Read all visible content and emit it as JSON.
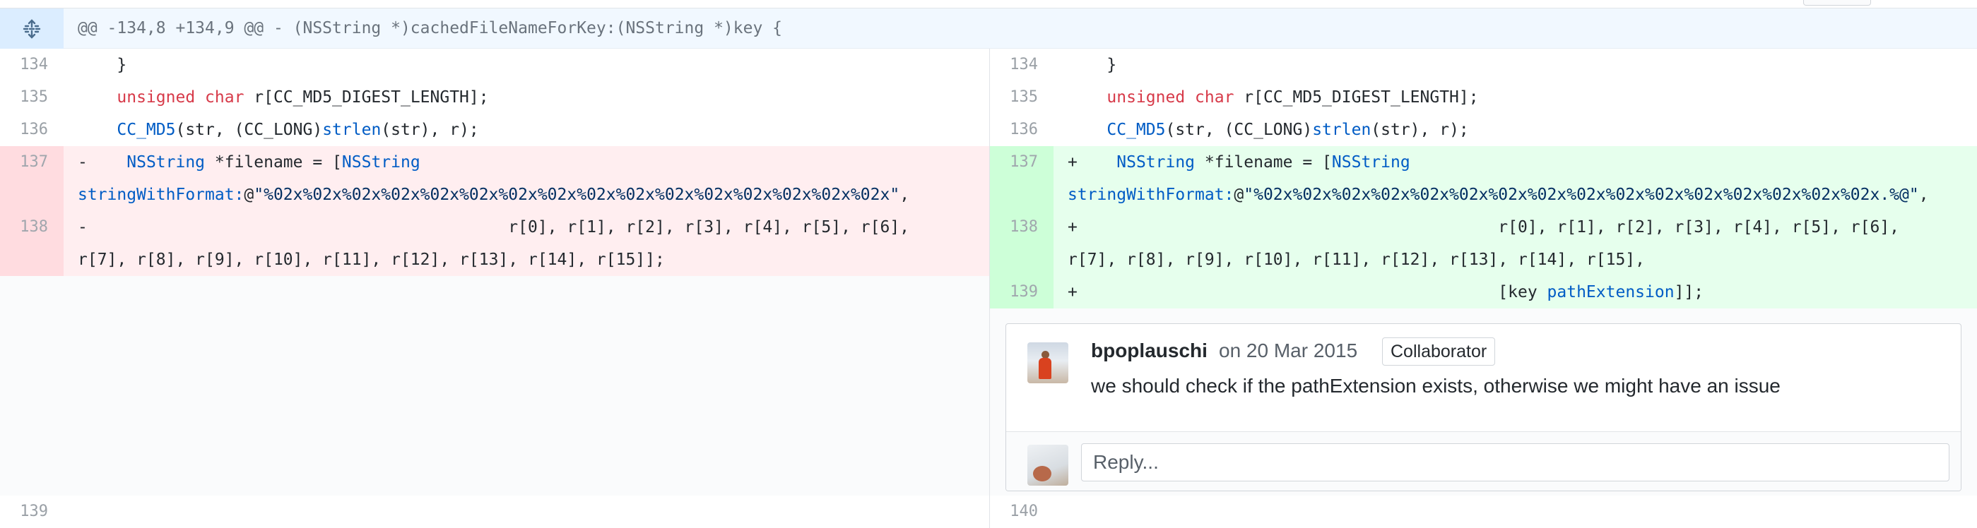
{
  "hunk": {
    "header": "@@ -134,8 +134,9 @@ - (NSString *)cachedFileNameForKey:(NSString *)key {",
    "expand_icon": "unfold-icon"
  },
  "left": {
    "nums": [
      "134",
      "135",
      "136",
      "137",
      "138",
      "139"
    ]
  },
  "right": {
    "nums": [
      "134",
      "135",
      "136",
      "137",
      "138",
      "139",
      "140"
    ]
  },
  "code": {
    "l134": "    }",
    "unsigned": "unsigned",
    "char": "char",
    "l135_rest": " r[CC_MD5_DIGEST_LENGTH];",
    "ccmd5": "CC_MD5",
    "l136_mid": "(str, (CC_LONG)",
    "strlen": "strlen",
    "l136_end": "(str), r);",
    "del_marker": "-",
    "add_marker": "+",
    "nsstring": "NSString",
    "filename_mid": " *filename = [",
    "swf": "stringWithFormat:",
    "at": "@",
    "fmt_old": "\"%02x%02x%02x%02x%02x%02x%02x%02x%02x%02x%02x%02x%02x%02x%02x%02x\"",
    "fmt_new": "\"%02x%02x%02x%02x%02x%02x%02x%02x%02x%02x%02x%02x%02x%02x%02x%02x.%@\"",
    "comma": ",",
    "r_a": "r[0], r[1], r[2], r[3], r[4], r[5], r[6],",
    "r_b_old": "r[7], r[8], r[9], r[10], r[11], r[12], r[13], r[14], r[15]];",
    "r_b_new": "r[7], r[8], r[9], r[10], r[11], r[12], r[13], r[14], r[15],",
    "key_open": "[key ",
    "path_ext": "pathExtension",
    "key_close": "]];"
  },
  "comment": {
    "author": "bpoplauschi",
    "date": "on 20 Mar 2015",
    "badge": "Collaborator",
    "body": "we should check if the pathExtension exists, otherwise we might have an issue",
    "reply_placeholder": "Reply..."
  },
  "colors": {
    "deletion_bg": "#ffeef0",
    "addition_bg": "#e6ffed",
    "hunk_bg": "#f1f8ff",
    "keyword": "#d73a49",
    "function": "#005cc5"
  }
}
